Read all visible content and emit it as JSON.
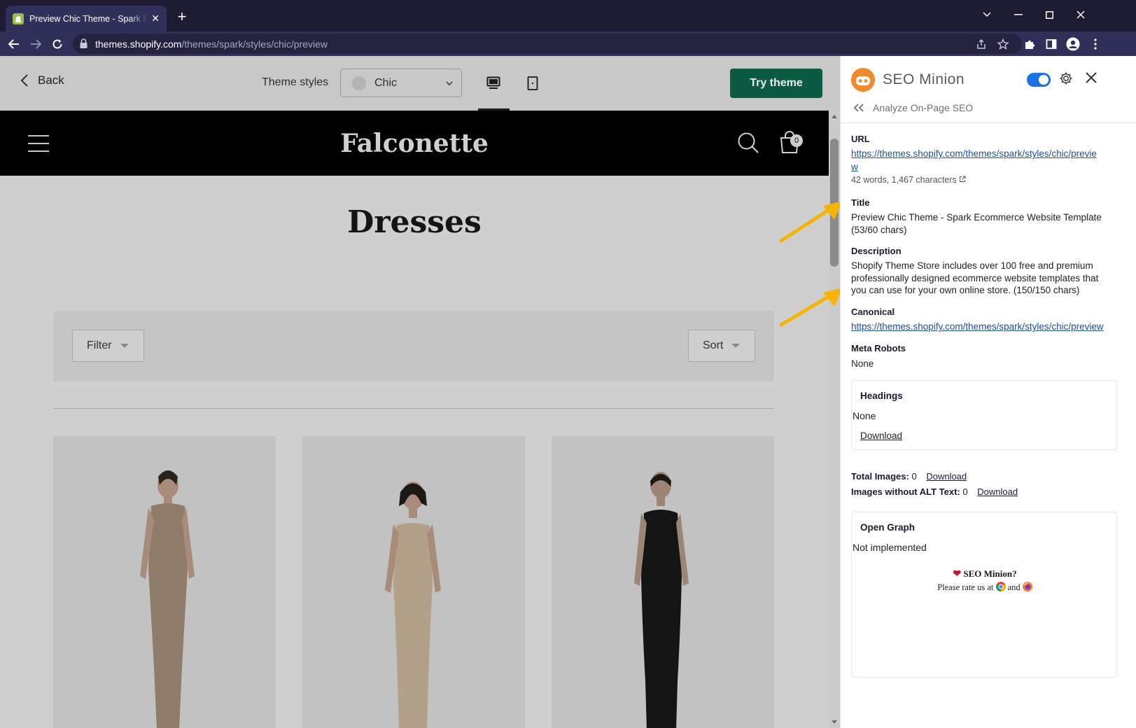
{
  "browser": {
    "tab_title": "Preview Chic Theme - Spark Ecommerce Website Template",
    "url_host": "themes.shopify.com",
    "url_path": "/themes/spark/styles/chic/preview"
  },
  "shopify_bar": {
    "back_label": "Back",
    "theme_styles_label": "Theme styles",
    "theme_style_value": "Chic",
    "try_theme_label": "Try theme"
  },
  "store": {
    "brand": "Falconette",
    "cart_count": "0",
    "collection_title": "Dresses",
    "filter_label": "Filter",
    "sort_label": "Sort"
  },
  "products": [
    {
      "dress_color": "#8f7c69",
      "skin": "#a88c79"
    },
    {
      "dress_color": "#b3a089",
      "skin": "#a88c79"
    },
    {
      "dress_color": "#141414",
      "skin": "#9c8574"
    }
  ],
  "seo_panel": {
    "title": "SEO Minion",
    "subtitle": "Analyze On-Page SEO",
    "url_label": "URL",
    "url_value": "https://themes.shopify.com/themes/spark/styles/chic/preview",
    "url_stats": "42 words, 1,467 characters",
    "title_label": "Title",
    "title_value": "Preview Chic Theme - Spark Ecommerce Website Template (53/60 chars)",
    "description_label": "Description",
    "description_value": "Shopify Theme Store includes over 100 free and premium professionally designed ecommerce website templates that you can use for your own online store. (150/150 chars)",
    "canonical_label": "Canonical",
    "canonical_value": "https://themes.shopify.com/themes/spark/styles/chic/preview",
    "meta_robots_label": "Meta Robots",
    "meta_robots_value": "None",
    "headings_title": "Headings",
    "headings_value": "None",
    "headings_download": "Download",
    "total_images_label": "Total Images:",
    "total_images_value": "0",
    "total_images_download": "Download",
    "images_no_alt_label": "Images without ALT Text:",
    "images_no_alt_value": "0",
    "images_no_alt_download": "Download",
    "og_title": "Open Graph",
    "og_value": "Not implemented",
    "rate_line1": "SEO Minion?",
    "rate_line2_pre": "Please rate us at",
    "rate_line2_and": "and"
  },
  "colors": {
    "accent_toggle": "#1a73e8",
    "try_theme": "#0b5a44",
    "annotation_arrow": "#f5b400",
    "link": "#1a4f9c"
  },
  "icons": [
    "shopify-favicon",
    "close-icon",
    "plus-icon",
    "chevron-down-icon",
    "minimize-icon",
    "maximize-icon",
    "back-arrow-icon",
    "forward-arrow-icon",
    "reload-icon",
    "lock-icon",
    "share-icon",
    "star-icon",
    "puzzle-icon",
    "sidepanel-icon",
    "profile-icon",
    "menu-icon",
    "chevron-left-icon",
    "desktop-icon",
    "mobile-icon",
    "hamburger-icon",
    "search-icon",
    "cart-icon",
    "seo-minion-logo-icon",
    "gear-icon",
    "double-chevron-left-icon",
    "external-link-icon",
    "heart-icon",
    "chrome-icon",
    "firefox-icon"
  ]
}
